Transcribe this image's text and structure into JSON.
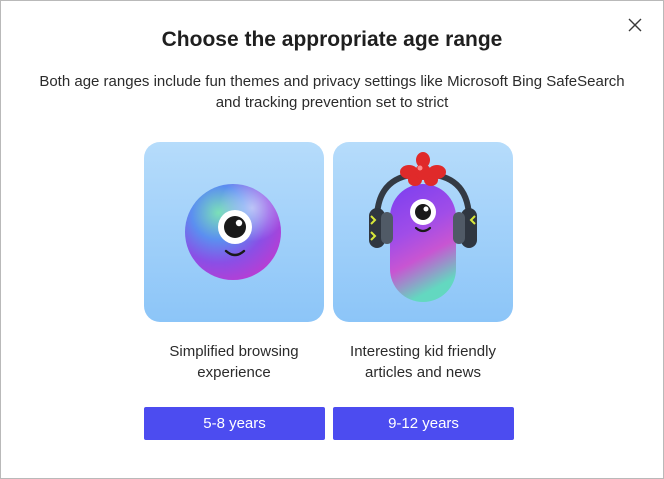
{
  "dialog": {
    "title": "Choose the appropriate age range",
    "subtitle_line1": "Both age ranges include fun themes and privacy settings like Microsoft Bing SafeSearch",
    "subtitle_line2": "and tracking prevention set to strict",
    "close_icon": "close-icon"
  },
  "options": [
    {
      "illustration": "round-one-eyed-character",
      "desc_line1": "Simplified browsing",
      "desc_line2": "experience",
      "button_label": "5-8 years"
    },
    {
      "illustration": "one-eyed-character-with-headphones",
      "desc_line1": "Interesting kid friendly",
      "desc_line2": "articles and news",
      "button_label": "9-12 years"
    }
  ],
  "colors": {
    "button": "#4c4cf0",
    "card_top": "#b6dcfb",
    "card_bottom": "#8cc5f8"
  }
}
